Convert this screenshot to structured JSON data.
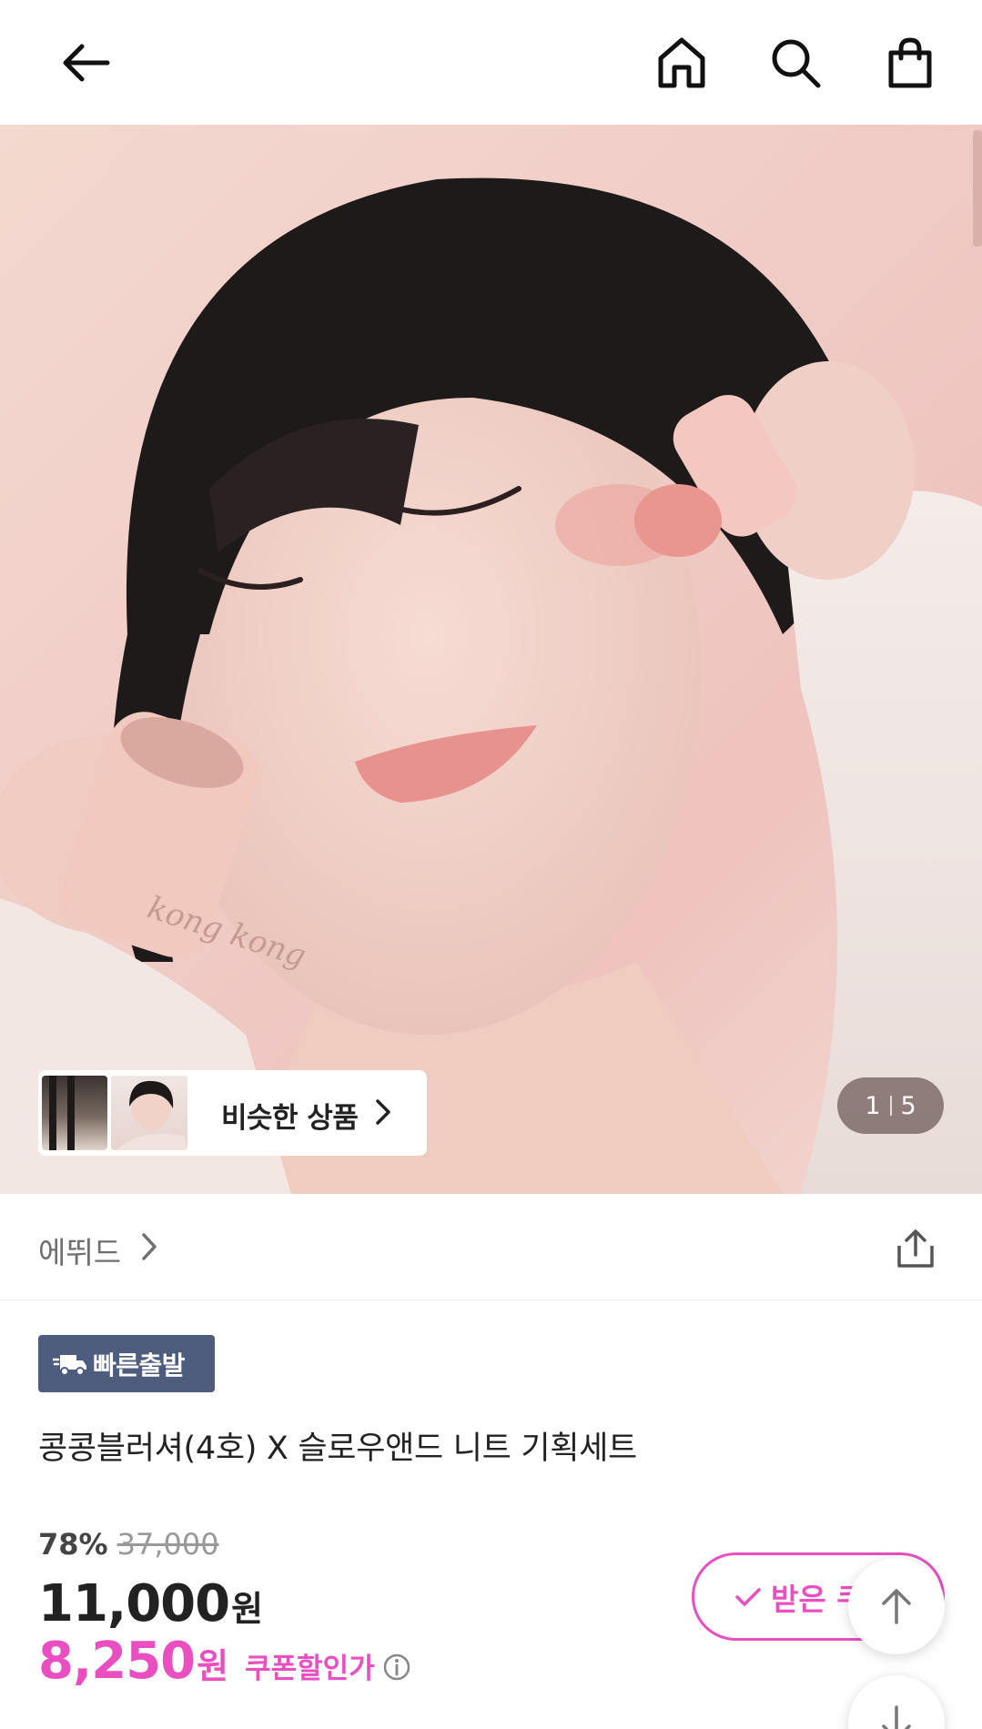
{
  "nav": {
    "back_icon": "arrow-left-icon",
    "home_icon": "home-icon",
    "search_icon": "search-icon",
    "cart_icon": "shopping-bag-icon"
  },
  "hero": {
    "similar_products_label": "비슷한 상품",
    "pager_current": "1",
    "pager_total": "5"
  },
  "brand": {
    "name": "에뛰드"
  },
  "badge": {
    "label": "빠른출발",
    "color": "#4e5d7e"
  },
  "product": {
    "title": "콩콩블러셔(4호) X 슬로우앤드 니트 기획세트"
  },
  "price": {
    "discount_rate": "78%",
    "original_price": "37,000",
    "sale_price": "11,000",
    "sale_unit": "원",
    "coupon_price": "8,250",
    "coupon_unit": "원",
    "coupon_label": "쿠폰할인가",
    "accent_color": "#e94fc1"
  },
  "coupon_button": {
    "label": "받은 쿠"
  }
}
